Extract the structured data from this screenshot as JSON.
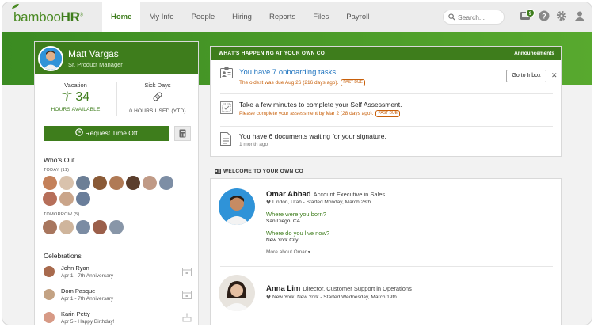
{
  "logo": {
    "prefix": "bamboo",
    "suffix": "HR",
    "reg": "®"
  },
  "nav": [
    {
      "label": "Home"
    },
    {
      "label": "My Info"
    },
    {
      "label": "People"
    },
    {
      "label": "Hiring"
    },
    {
      "label": "Reports"
    },
    {
      "label": "Files"
    },
    {
      "label": "Payroll"
    }
  ],
  "search": {
    "placeholder": "Search..."
  },
  "inbox_badge": "9",
  "profile": {
    "name": "Matt Vargas",
    "title": "Sr. Product Manager"
  },
  "timeoff": {
    "vacation": {
      "label": "Vacation",
      "value": "34",
      "caption": "HOURS AVAILABLE"
    },
    "sick": {
      "label": "Sick Days",
      "caption": "0 HOURS USED (YTD)"
    },
    "request_label": "Request Time Off"
  },
  "whos_out": {
    "title": "Who's Out",
    "today_label": "TODAY (11)",
    "tomorrow_label": "TOMORROW (5)"
  },
  "celebrations": {
    "title": "Celebrations",
    "items": [
      {
        "name": "John Ryan",
        "detail": "Apr 1 - 7th Anniversary"
      },
      {
        "name": "Dom Pasque",
        "detail": "Apr 1 - 7th Anniversary"
      },
      {
        "name": "Karin Petty",
        "detail": "Apr 5 - Happy Birthday!"
      }
    ]
  },
  "happening": {
    "header": "WHAT'S HAPPENING AT YOUR OWN CO",
    "announcements": "Announcements",
    "tasks": {
      "main": "You have 7 onboarding tasks.",
      "sub": "The oldest was due Aug 26 (216 days ago).",
      "tag": "PAST DUE",
      "button": "Go to Inbox",
      "close": "✕"
    },
    "assessment": {
      "main": "Take a few minutes to complete your Self Assessment.",
      "sub": "Please complete your assessment by Mar 2 (28 days ago).",
      "tag": "PAST DUE"
    },
    "documents": {
      "main": "You have 6 documents waiting for your signature.",
      "sub": "1 month ago"
    }
  },
  "welcome": {
    "header": "WELCOME TO YOUR OWN CO",
    "people": [
      {
        "name": "Omar Abbad",
        "role": "Account Executive in Sales",
        "location": "Lindon, Utah - Started Monday, March 28th",
        "q1": "Where were you born?",
        "a1": "San Diego, CA",
        "q2": "Where do you live now?",
        "a2": "New York City",
        "more": "More about Omar"
      },
      {
        "name": "Anna Lim",
        "role": "Director, Customer Support in Operations",
        "location": "New York, New York - Started Wednesday, March 19th"
      }
    ]
  },
  "colors": {
    "brand_green": "#3e7d1c",
    "link_blue": "#1f74bf",
    "past_due": "#c8600b"
  }
}
